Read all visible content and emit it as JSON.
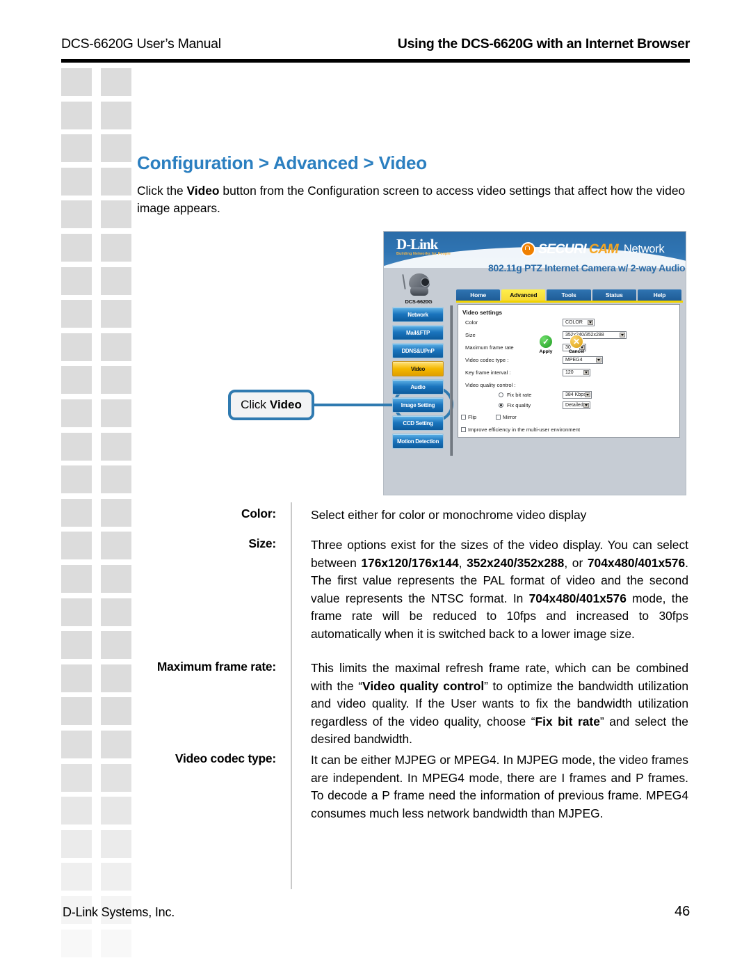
{
  "header": {
    "left": "DCS-6620G User’s Manual",
    "right": "Using the DCS-6620G with an Internet Browser"
  },
  "section": {
    "title": "Configuration > Advanced > Video",
    "intro_prefix": "Click the ",
    "intro_bold": "Video",
    "intro_suffix": " button from the Configuration screen to access video settings that affect how the video image appears."
  },
  "callout": {
    "prefix": "Click",
    "bold": "Video"
  },
  "device_screenshot": {
    "brand": "D-Link",
    "brand_tagline": "Building Networks for People",
    "securicam_first": "SECURI",
    "securicam_second": "CAM",
    "securicam_network": "Network",
    "product_subtitle": "802.11g PTZ Internet Camera w/ 2-way Audio",
    "tabs": [
      {
        "label": "Home",
        "active": false
      },
      {
        "label": "Advanced",
        "active": true
      },
      {
        "label": "Tools",
        "active": false
      },
      {
        "label": "Status",
        "active": false
      },
      {
        "label": "Help",
        "active": false
      }
    ],
    "camera_model": "DCS-6620G",
    "sidebar_buttons": [
      {
        "label": "Network",
        "highlight": false
      },
      {
        "label": "Mail&FTP",
        "highlight": false
      },
      {
        "label": "DDNS&UPnP",
        "highlight": false
      },
      {
        "label": "Video",
        "highlight": true
      },
      {
        "label": "Audio",
        "highlight": false
      },
      {
        "label": "Image Setting",
        "highlight": false
      },
      {
        "label": "CCD Setting",
        "highlight": false
      },
      {
        "label": "Motion Detection",
        "highlight": false
      }
    ],
    "panel": {
      "title": "Video settings",
      "fields": [
        {
          "label": "Color",
          "value": "COLOR"
        },
        {
          "label": "Size",
          "value": "352x240/352x288"
        },
        {
          "label": "Maximum frame rate",
          "value": "30"
        },
        {
          "label": "Video codec type :",
          "value": "MPEG4"
        },
        {
          "label": "Key frame interval :",
          "value": "120"
        }
      ],
      "quality_label": "Video quality control :",
      "quality_options": [
        {
          "label": "Fix bit rate",
          "selected": false,
          "value": "384 Kbps"
        },
        {
          "label": "Fix quality",
          "selected": true,
          "value": "Detailed"
        }
      ],
      "checkboxes": [
        {
          "label": "Flip",
          "checked": false
        },
        {
          "label": "Mirror",
          "checked": false
        },
        {
          "label": "Improve efficiency in the multi-user environment",
          "checked": false
        }
      ],
      "apply_label": "Apply",
      "cancel_label": "Cancel"
    }
  },
  "definitions": [
    {
      "term": "Color:",
      "desc_html": "Select either for color or monochrome video display",
      "justify": false
    },
    {
      "term": "Size:",
      "desc_html": "Three options exist for the sizes of the video display. You can select between <b>176x120/176x144</b>, <b>352x240/352x288</b>, or <b>704x480/401x576</b>. The first value represents the PAL format of video and the second value represents the NTSC format. In <b>704x480/401x576</b> mode, the frame rate will be reduced to 10fps and increased to 30fps automatically when it is switched back to a lower image size.",
      "justify": true
    },
    {
      "term": "Maximum frame rate:",
      "desc_html": "This limits the maximal refresh frame rate, which can be combined with the “<b>Video quality control</b>” to optimize the bandwidth utilization and video quality. If the User wants to fix the bandwidth utilization regardless of the video quality, choose “<b>Fix bit rate</b>” and select the desired bandwidth.",
      "justify": true
    },
    {
      "term": "Video codec type:",
      "desc_html": "It can be either MJPEG or MPEG4. In MJPEG mode, the video frames are independent. In MPEG4 mode, there are I frames and P frames. To decode a P frame need the information of previous frame. MPEG4 consumes much less network bandwidth than MJPEG.",
      "justify": true
    }
  ],
  "footer": {
    "company": "D-Link Systems, Inc.",
    "page_number": "46"
  },
  "colors": {
    "accent_blue": "#2b7fc0",
    "callout_blue": "#2f7ab0",
    "deco_gray": "#dcdcdc"
  }
}
